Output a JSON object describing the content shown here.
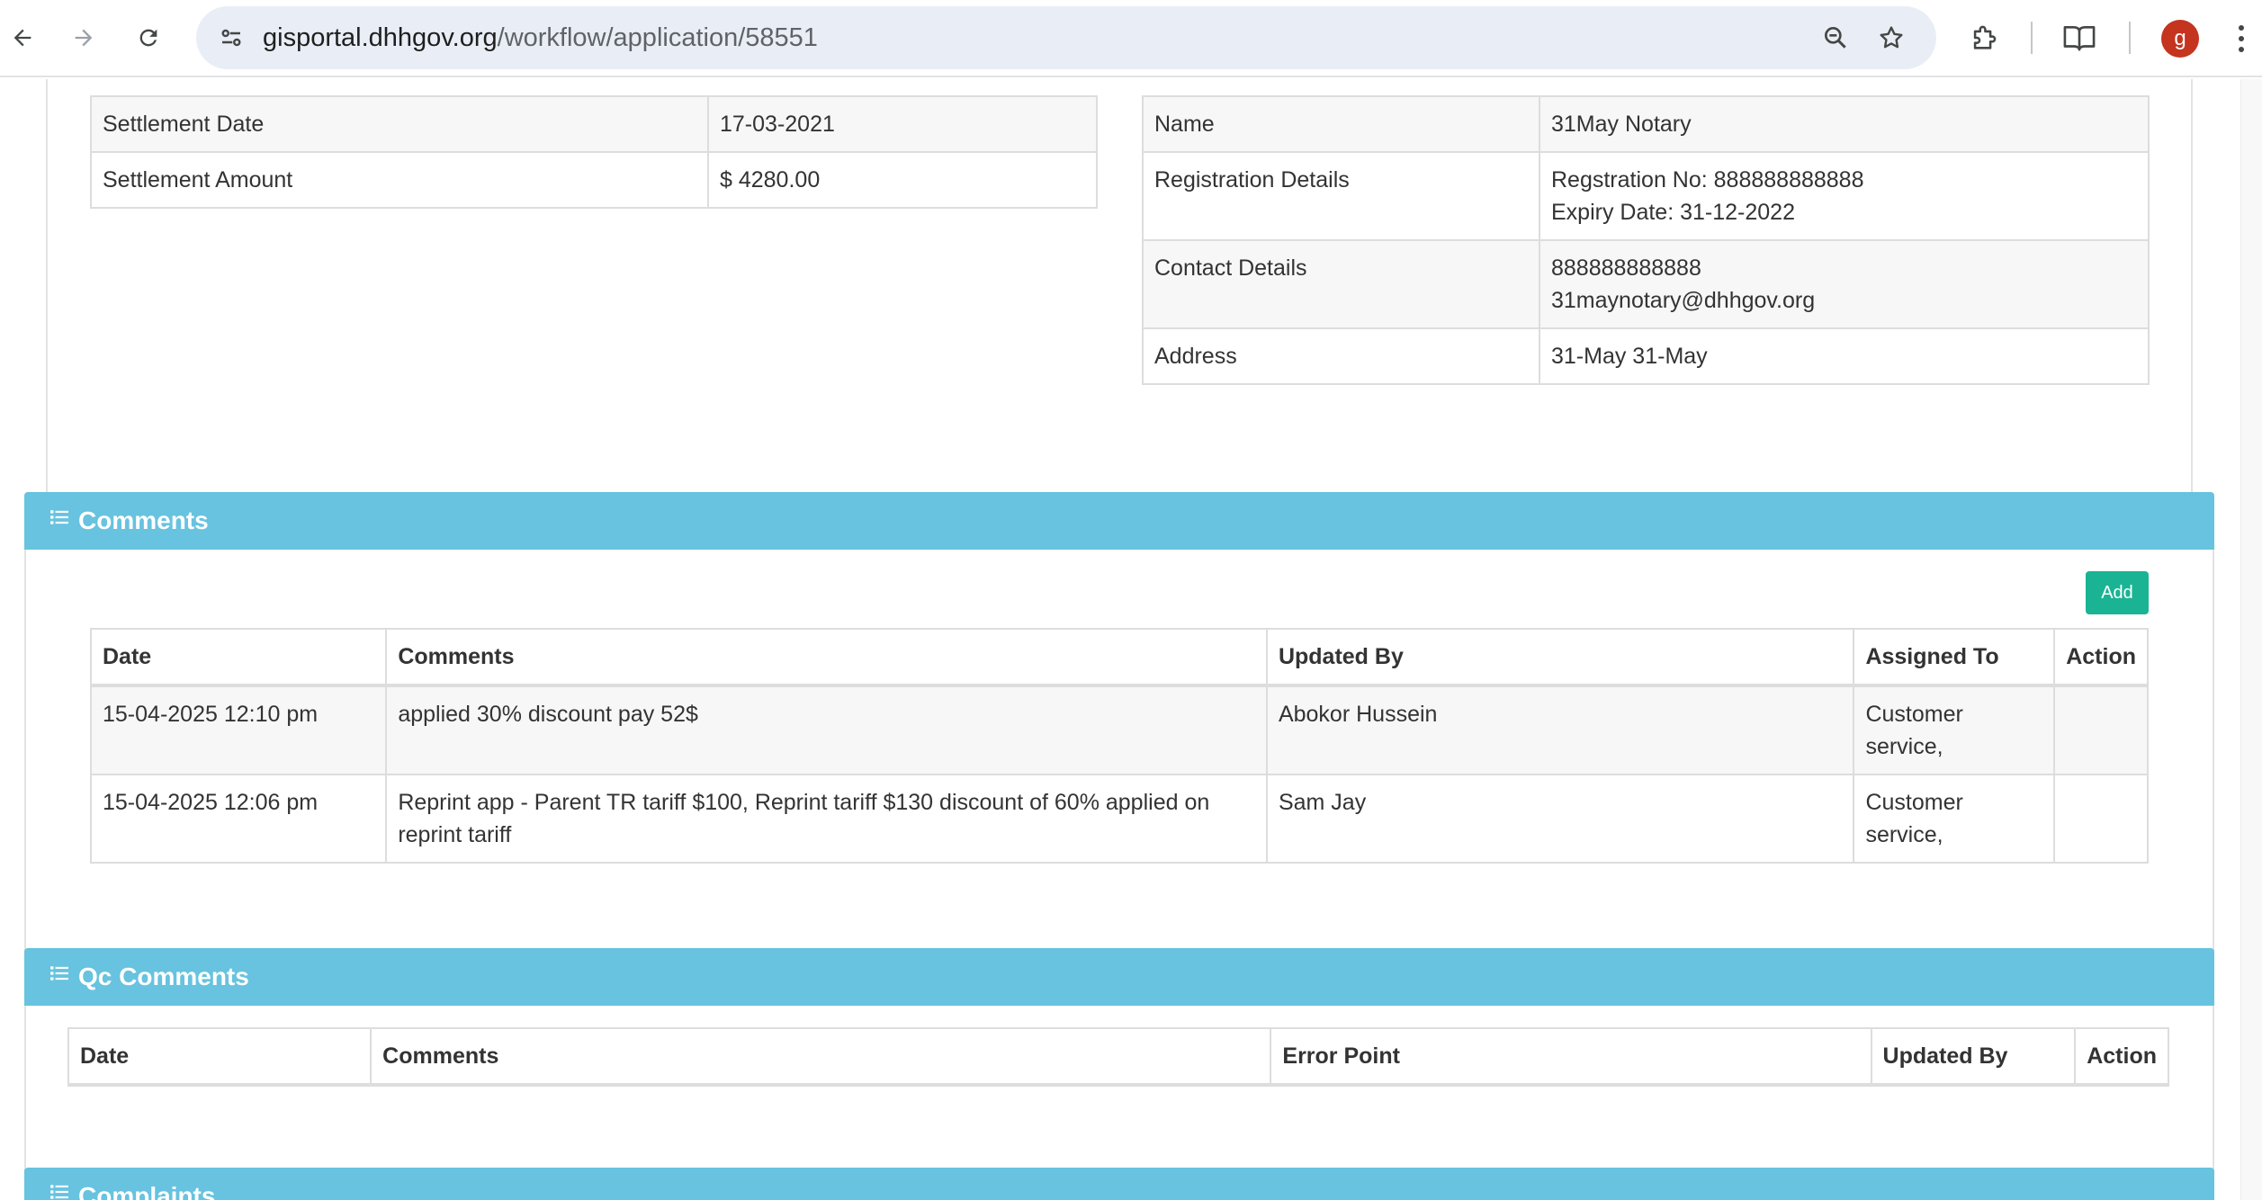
{
  "browser": {
    "url_host": "gisportal.dhhgov.org",
    "url_path": "/workflow/application/58551",
    "avatar_letter": "g",
    "avatar_color": "#c5341f"
  },
  "settlement": {
    "rows": [
      {
        "label": "Settlement Date",
        "value": "17-03-2021"
      },
      {
        "label": "Settlement Amount",
        "value": "$ 4280.00"
      }
    ]
  },
  "notary": {
    "name_label": "Name",
    "name_value": "31May Notary",
    "registration_label": "Registration Details",
    "registration_line1": "Regstration No: 888888888888",
    "registration_line2": "Expiry Date: 31-12-2022",
    "contact_label": "Contact Details",
    "contact_line1": "888888888888",
    "contact_line2": "31maynotary@dhhgov.org",
    "address_label": "Address",
    "address_value": "31-May 31-May"
  },
  "comments": {
    "title": "Comments",
    "add_label": "Add",
    "add_color": "#1ab394",
    "header_color": "#67c3df",
    "columns": [
      "Date",
      "Comments",
      "Updated By",
      "Assigned To",
      "Action"
    ],
    "rows": [
      {
        "date": "15-04-2025 12:10 pm",
        "comment": "applied 30% discount pay 52$",
        "updated_by": "Abokor Hussein",
        "assigned_to": "Customer service,",
        "action": ""
      },
      {
        "date": "15-04-2025 12:06 pm",
        "comment": "Reprint app - Parent TR tariff $100, Reprint tariff $130 discount of 60% applied on reprint tariff",
        "updated_by": "Sam Jay",
        "assigned_to": "Customer service,",
        "action": ""
      }
    ]
  },
  "qc_comments": {
    "title": "Qc Comments",
    "columns": [
      "Date",
      "Comments",
      "Error Point",
      "Updated By",
      "Action"
    ]
  },
  "complaints": {
    "title": "Complaints"
  }
}
